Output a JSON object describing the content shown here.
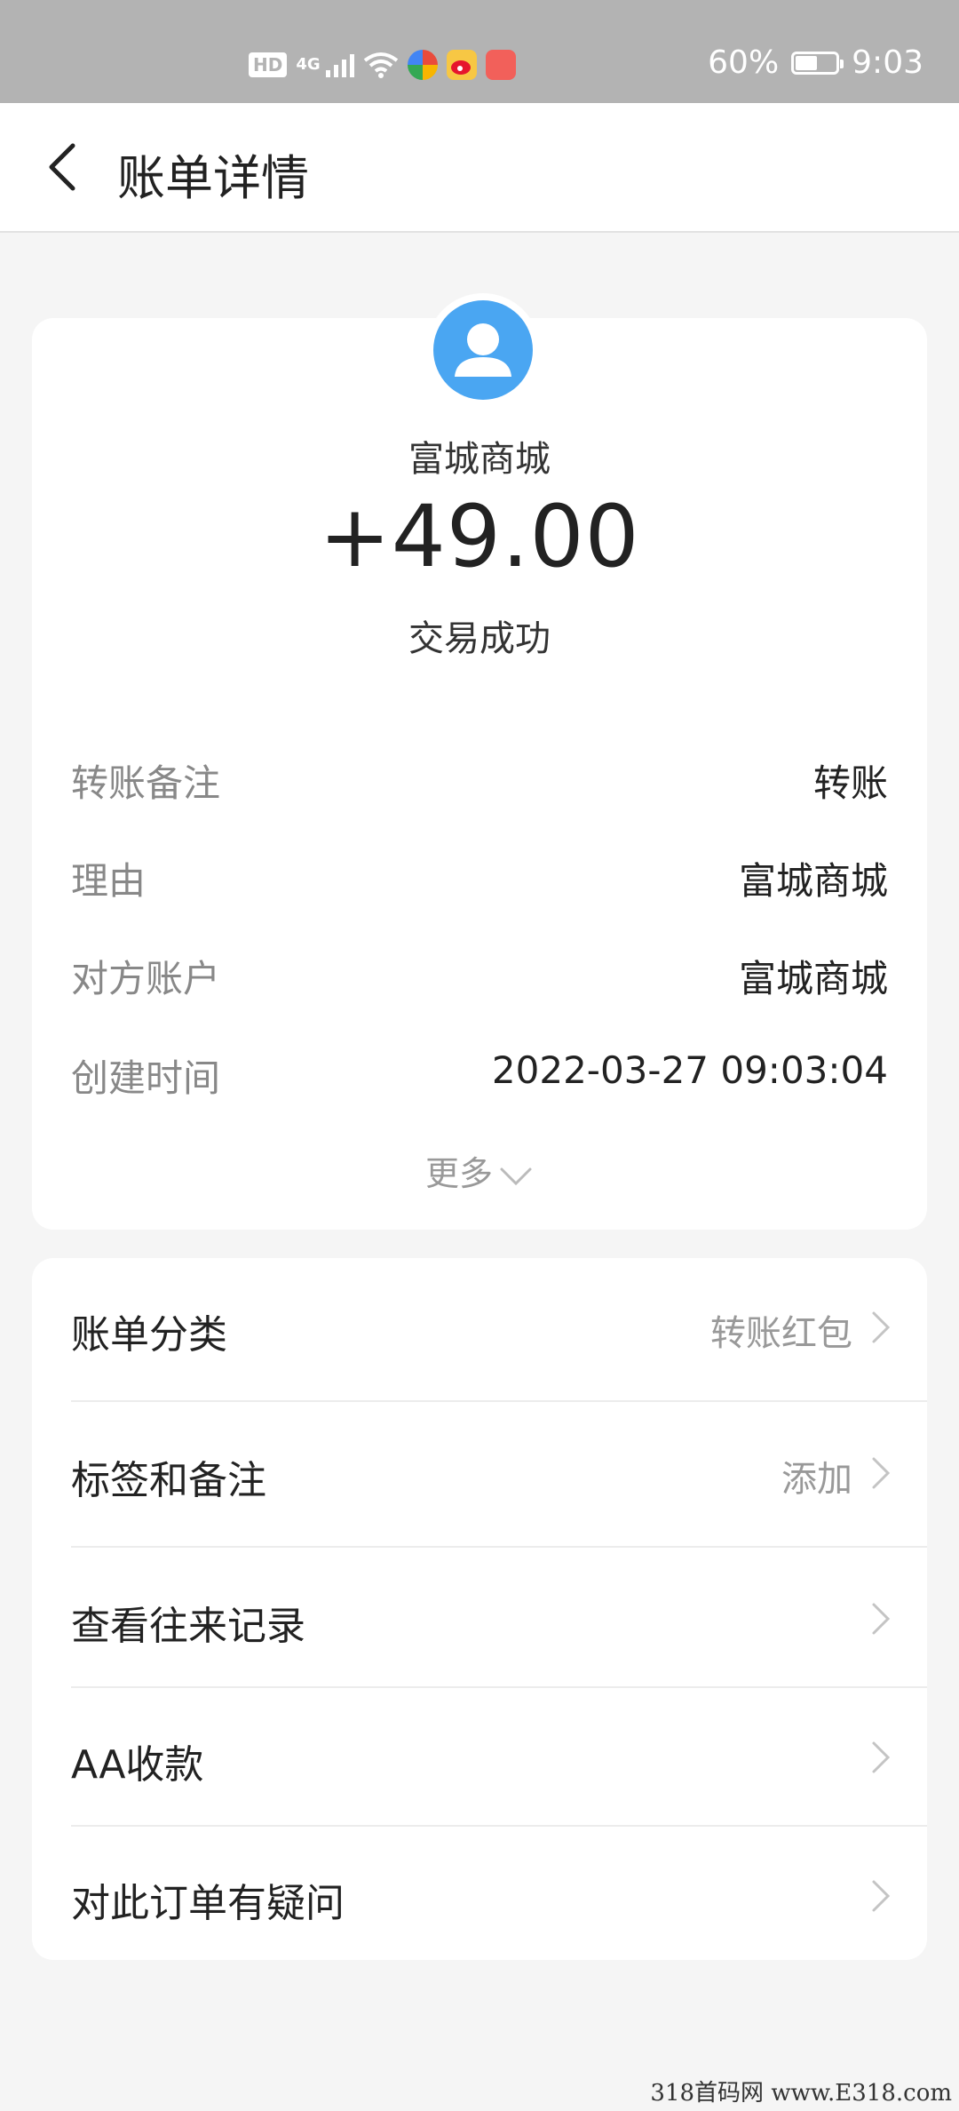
{
  "status_bar": {
    "hd": "HD",
    "network": "4G",
    "battery_percent": "60%",
    "time": "9:03",
    "battery_level": 0.6,
    "app_icons": [
      "multicolor-app-icon",
      "weibo-icon",
      "red-app-icon"
    ]
  },
  "header": {
    "title": "账单详情"
  },
  "transaction": {
    "merchant": "富城商城",
    "amount": "+49.00",
    "status": "交易成功",
    "details": [
      {
        "label": "转账备注",
        "value": "转账"
      },
      {
        "label": "理由",
        "value": "富城商城"
      },
      {
        "label": "对方账户",
        "value": "富城商城"
      },
      {
        "label": "创建时间",
        "value": "2022-03-27 09:03:04"
      }
    ],
    "more_label": "更多"
  },
  "actions": [
    {
      "label": "账单分类",
      "value": "转账红包"
    },
    {
      "label": "标签和备注",
      "value": "添加"
    },
    {
      "label": "查看往来记录",
      "value": ""
    },
    {
      "label": "AA收款",
      "value": ""
    },
    {
      "label": "对此订单有疑问",
      "value": ""
    }
  ],
  "watermark": "318首码网  www.E318.com",
  "colors": {
    "status_bar_bg": "#b3b3b3",
    "page_bg": "#f5f5f5",
    "avatar_blue": "#4aa6f2",
    "secondary_text": "#888888"
  }
}
